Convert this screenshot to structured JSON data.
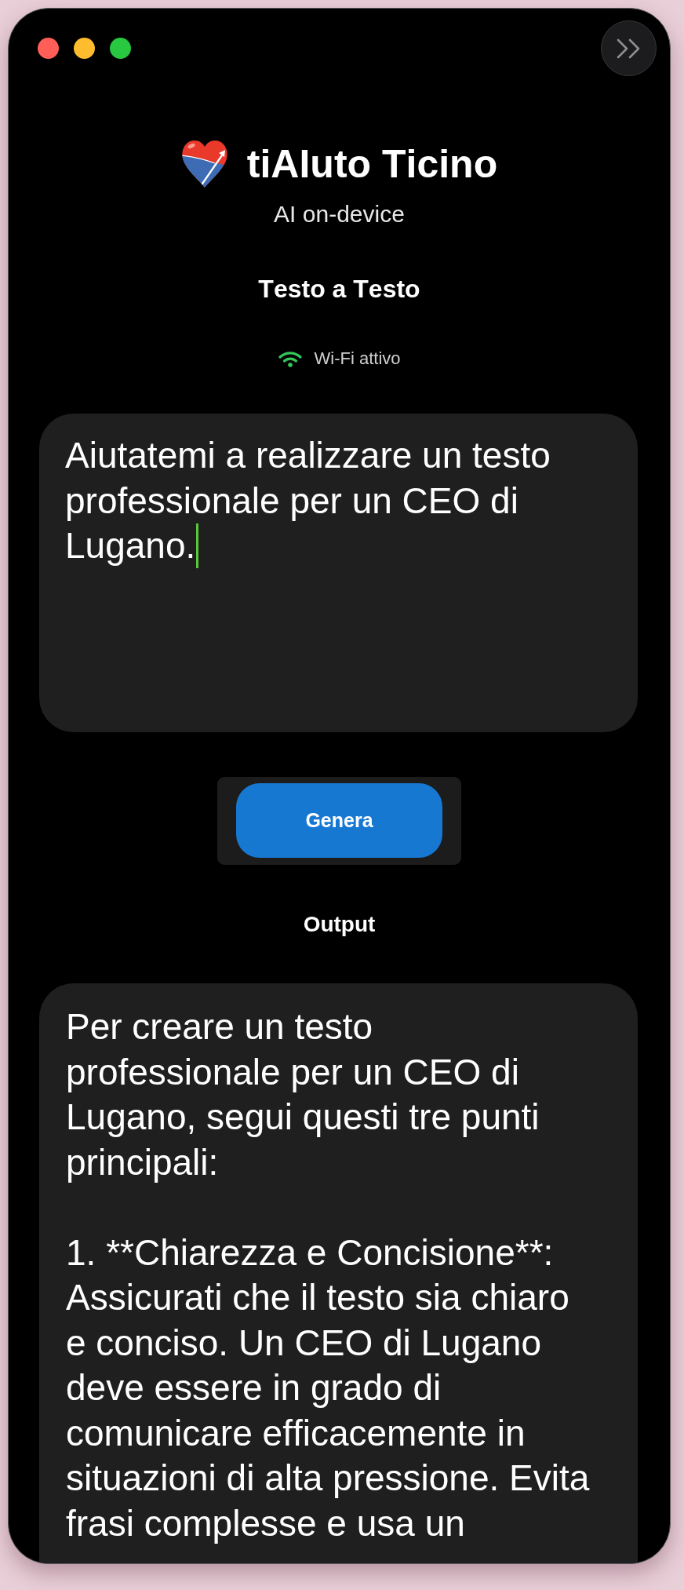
{
  "header": {
    "app_name": "tiAIuto Ticino",
    "subtitle": "AI on-device"
  },
  "mode_title": "Testo a Testo",
  "network": {
    "label": "Wi-Fi attivo",
    "active": true
  },
  "prompt": {
    "value": "Aiutatemi a realizzare un testo professionale per un CEO di Lugano.",
    "focused": true
  },
  "generate_button": {
    "label": "Genera"
  },
  "output": {
    "title": "Output",
    "text": "Per creare un testo professionale per un CEO di Lugano, segui questi tre punti principali:\n\n1. **Chiarezza e Concisione**: Assicurati che il testo sia chiaro e conciso. Un CEO di Lugano deve essere in grado di comunicare efficacemente in situazioni di alta pressione. Evita frasi complesse e usa un"
  }
}
